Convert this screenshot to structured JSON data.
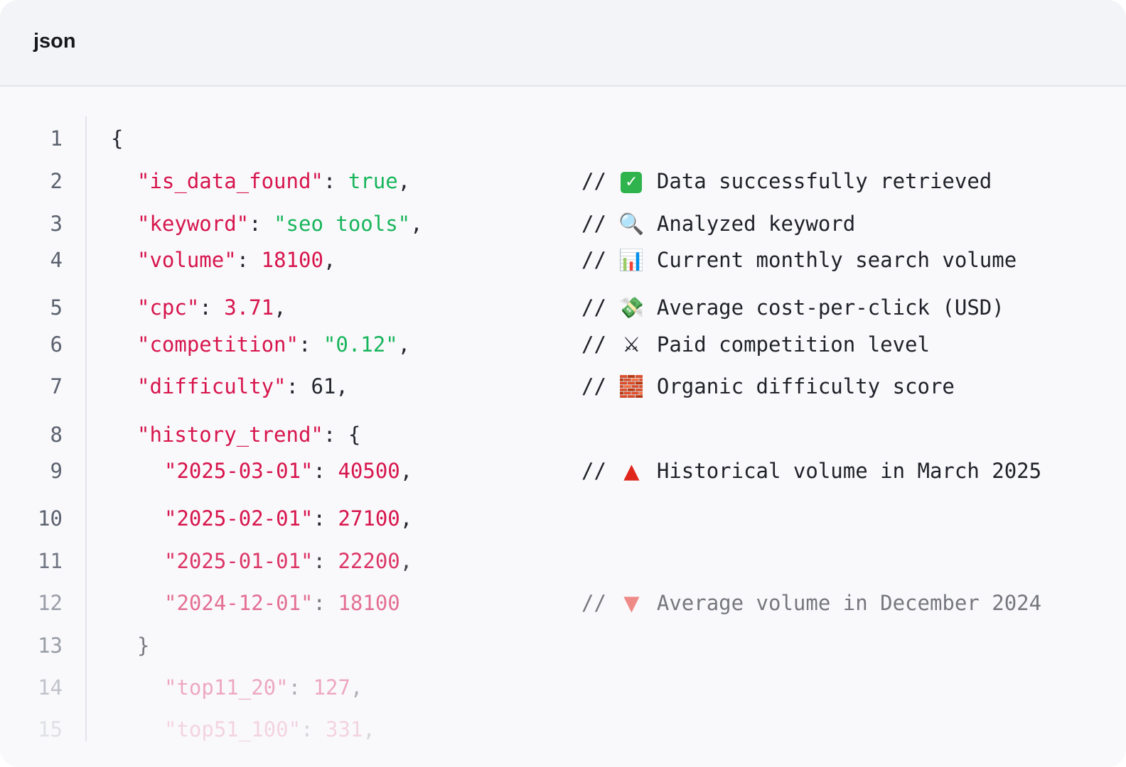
{
  "header": {
    "language_label": "json"
  },
  "lines": [
    {
      "num": "1"
    },
    {
      "num": "2",
      "key": "\"is_data_found\"",
      "value": "true",
      "comment": "Data successfully retrieved",
      "icon": "check-mark-icon"
    },
    {
      "num": "3",
      "key": "\"keyword\"",
      "value": "\"seo tools\"",
      "comment": "Analyzed keyword",
      "icon": "magnifier-icon"
    },
    {
      "num": "4",
      "key": "\"volume\"",
      "value": "18100",
      "comment": "Current monthly search volume",
      "icon": "bar-chart-icon"
    },
    {
      "num": "5",
      "key": "\"cpc\"",
      "value": "3.71",
      "comment": "Average cost-per-click (USD)",
      "icon": "money-icon"
    },
    {
      "num": "6",
      "key": "\"competition\"",
      "value": "\"0.12\"",
      "comment": "Paid competition level",
      "icon": "crossed-swords-icon"
    },
    {
      "num": "7",
      "key": "\"difficulty\"",
      "value": "61",
      "comment": "Organic difficulty score",
      "icon": "bricks-icon"
    },
    {
      "num": "8",
      "key": "\"history_trend\""
    },
    {
      "num": "9",
      "key": "\"2025-03-01\"",
      "value": "40500",
      "comment": "Historical volume in March 2025",
      "icon": "red-triangle-up-icon"
    },
    {
      "num": "10",
      "key": "\"2025-02-01\"",
      "value": "27100"
    },
    {
      "num": "11",
      "key": "\"2025-01-01\"",
      "value": "22200"
    },
    {
      "num": "12",
      "key": "\"2024-12-01\"",
      "value": "18100",
      "comment": "Average volume in December 2024",
      "icon": "red-triangle-down-icon"
    },
    {
      "num": "13"
    },
    {
      "num": "14",
      "key": "\"top11_20\"",
      "value": "127"
    },
    {
      "num": "15",
      "key": "\"top51_100\"",
      "value": "331"
    }
  ],
  "syntax": {
    "open_brace": "{",
    "close_brace": "}",
    "colon": ": ",
    "comma": ",",
    "comment_marker": "//",
    "check_glyph": "✓",
    "search_glyph": "🔍",
    "chart_glyph": "📊",
    "money_glyph": "💸",
    "swords_glyph": "⚔",
    "bricks_glyph": "🧱",
    "up_glyph": "▲",
    "down_glyph": "▼"
  },
  "colors": {
    "key": "#d7154c",
    "string": "#17b55a",
    "number": "#d7154c",
    "boolean": "#17b55a",
    "punctuation": "#25272e",
    "comment": "#1f2128",
    "line_number": "#5b616e"
  }
}
